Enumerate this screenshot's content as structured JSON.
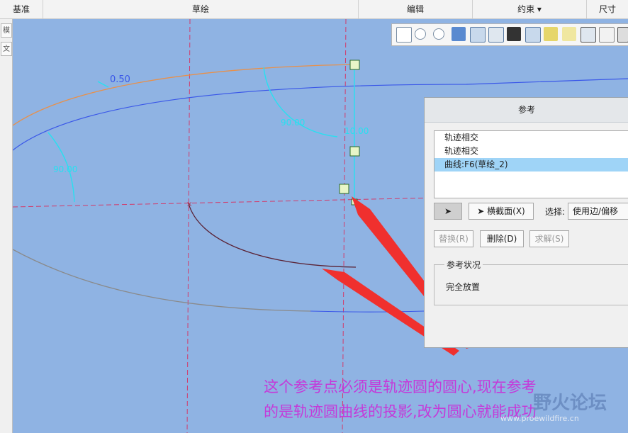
{
  "topbar": {
    "groups": [
      "基准",
      "草绘",
      "编辑",
      "约束 ▾",
      "尺寸"
    ]
  },
  "left_tabs": [
    "模型树",
    "文"
  ],
  "sketch": {
    "dim_angle_left": "90.00",
    "dim_angle_top": "90.00",
    "dim_vertical": "10.00",
    "dim_offset": "0.50"
  },
  "dialog": {
    "title": "参考",
    "references": [
      "轨迹相交",
      "轨迹相交",
      "曲线:F6(草绘_2)"
    ],
    "selected_index": 2,
    "cross_section_button": "横截面(X)",
    "select_label": "选择:",
    "select_value": "使用边/偏移",
    "replace_button": "替换(R)",
    "delete_button": "删除(D)",
    "solve_button": "求解(S)",
    "status_group_title": "参考状况",
    "status_text": "完全放置"
  },
  "annotation": {
    "line1": "这个参考点必须是轨迹圆的圆心,现在参考",
    "line2": "的是轨迹圆曲线的投影,改为圆心就能成功"
  },
  "watermark": {
    "title": "野火论坛",
    "url": "www.proewildfire.cn"
  },
  "colors": {
    "canvas": "#8fb3e3",
    "dimension": "#27e0f0",
    "annotation_text": "#c43ad9",
    "arrow": "#f0302e"
  }
}
